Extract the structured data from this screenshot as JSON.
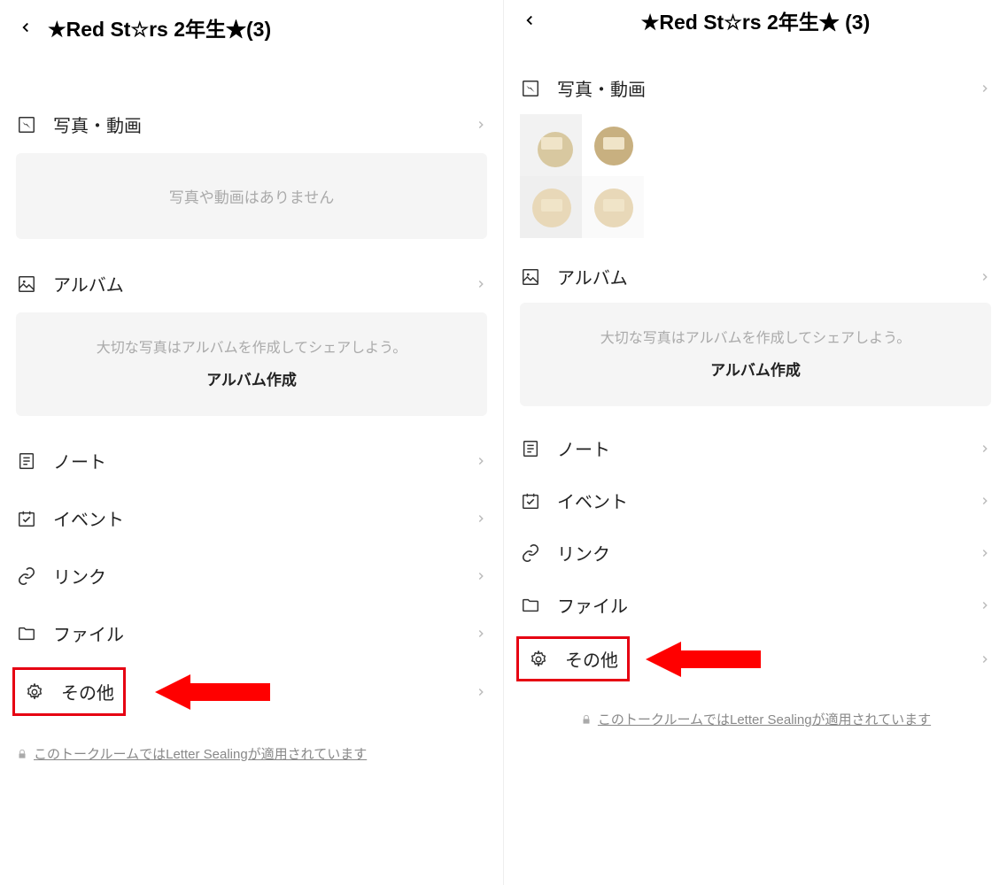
{
  "left": {
    "header_title": "★Red St☆rs 2年生★(3)",
    "sections": {
      "photos": {
        "label": "写真・動画",
        "empty": "写真や動画はありません"
      },
      "album": {
        "label": "アルバム",
        "desc": "大切な写真はアルバムを作成してシェアしよう。",
        "cta": "アルバム作成"
      },
      "note": {
        "label": "ノート"
      },
      "event": {
        "label": "イベント"
      },
      "link": {
        "label": "リンク"
      },
      "file": {
        "label": "ファイル"
      },
      "other": {
        "label": "その他"
      }
    },
    "footer": "このトークルームではLetter Sealingが適用されています"
  },
  "right": {
    "header_title": "★Red St☆rs 2年生★ (3)",
    "sections": {
      "photos": {
        "label": "写真・動画"
      },
      "album": {
        "label": "アルバム",
        "desc": "大切な写真はアルバムを作成してシェアしよう。",
        "cta": "アルバム作成"
      },
      "note": {
        "label": "ノート"
      },
      "event": {
        "label": "イベント"
      },
      "link": {
        "label": "リンク"
      },
      "file": {
        "label": "ファイル"
      },
      "other": {
        "label": "その他"
      }
    },
    "footer": "このトークルームではLetter Sealingが適用されています"
  },
  "annotation_color": "#e60012"
}
